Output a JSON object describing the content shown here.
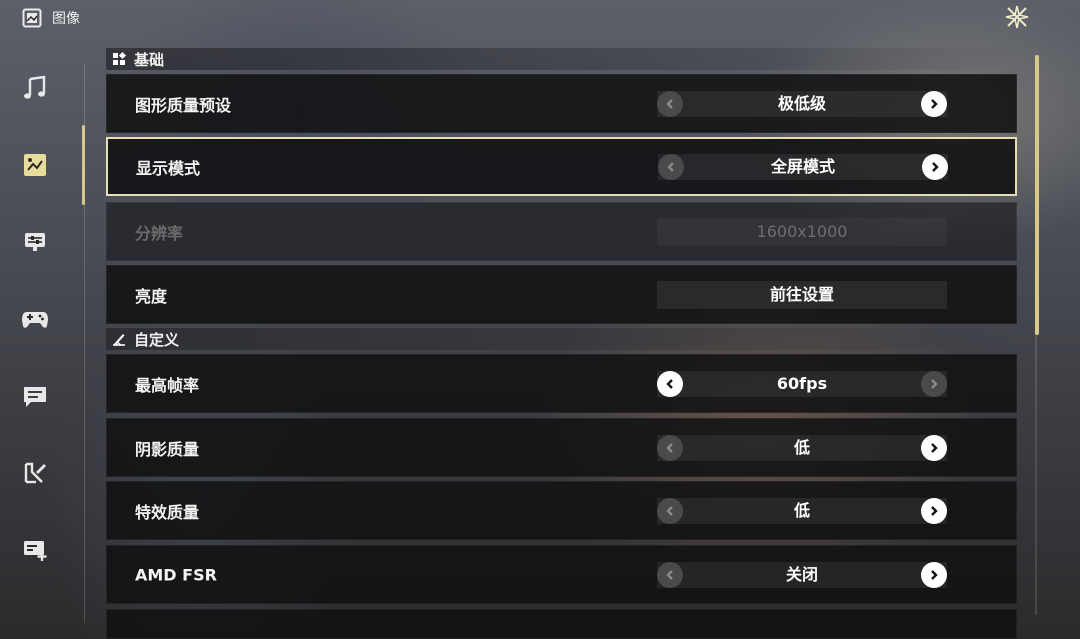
{
  "window": {
    "title": "图像"
  },
  "sections": {
    "basic": "基础",
    "custom": "自定义"
  },
  "rows": {
    "quality_preset": {
      "label": "图形质量预设",
      "value": "极低级"
    },
    "display_mode": {
      "label": "显示模式",
      "value": "全屏模式"
    },
    "resolution": {
      "label": "分辨率",
      "value": "1600x1000"
    },
    "brightness": {
      "label": "亮度",
      "value": "前往设置"
    },
    "max_fps": {
      "label": "最高帧率",
      "value": "60fps"
    },
    "shadow_quality": {
      "label": "阴影质量",
      "value": "低"
    },
    "effect_quality": {
      "label": "特效质量",
      "value": "低"
    },
    "amd_fsr": {
      "label": "AMD FSR",
      "value": "关闭"
    }
  },
  "sidebar": {
    "items": [
      "music-note-icon",
      "image-icon",
      "sliders-icon",
      "gamepad-icon",
      "chat-icon",
      "wrench-icon",
      "card-add-icon"
    ],
    "active": "image-icon"
  },
  "colors": {
    "accent": "#d8c98a",
    "selected_border": "#e6dfb0"
  }
}
